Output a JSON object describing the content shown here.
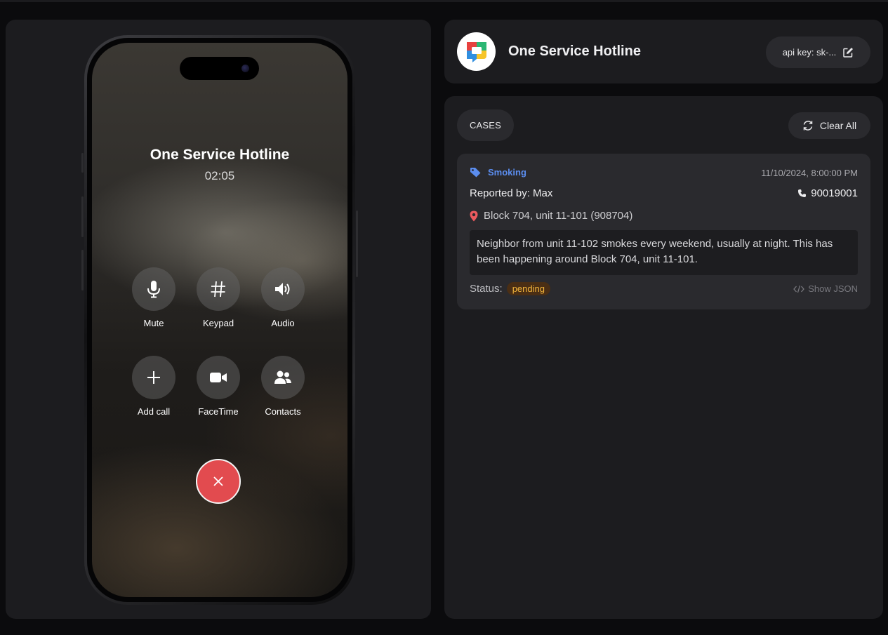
{
  "phone": {
    "caller_name": "One Service Hotline",
    "call_duration": "02:05",
    "controls": [
      {
        "label": "Mute",
        "icon": "microphone-icon"
      },
      {
        "label": "Keypad",
        "icon": "hash-icon"
      },
      {
        "label": "Audio",
        "icon": "speaker-icon"
      },
      {
        "label": "Add call",
        "icon": "plus-icon"
      },
      {
        "label": "FaceTime",
        "icon": "video-camera-icon"
      },
      {
        "label": "Contacts",
        "icon": "contacts-icon"
      }
    ],
    "end_call_icon": "close-icon"
  },
  "header": {
    "title": "One Service Hotline",
    "api_key_label": "api key: sk-..."
  },
  "cases": {
    "section_label": "CASES",
    "clear_all_label": "Clear All",
    "items": [
      {
        "category": "Smoking",
        "timestamp": "11/10/2024, 8:00:00 PM",
        "reported_by": "Reported by: Max",
        "phone": "90019001",
        "location": "Block 704, unit 11-101 (908704)",
        "description": "Neighbor from unit 11-102 smokes every weekend, usually at night. This has been happening around Block 704, unit 11-101.",
        "status_label": "Status:",
        "status": "pending",
        "show_json_label": "Show JSON"
      }
    ]
  },
  "colors": {
    "accent_blue": "#5b8def",
    "end_call_red": "#e24b4f",
    "pending_text": "#f2b53c",
    "pin_red": "#ec5a5e"
  }
}
